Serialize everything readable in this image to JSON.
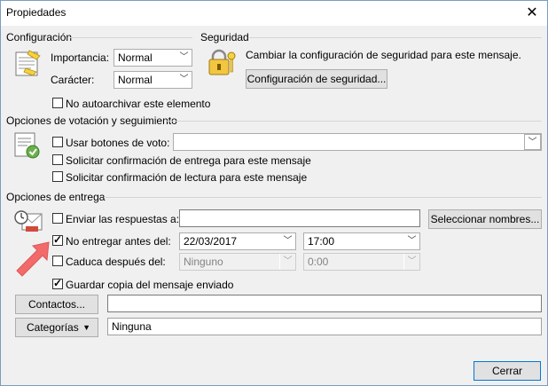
{
  "window": {
    "title": "Propiedades",
    "close_glyph": "✕"
  },
  "config": {
    "heading": "Configuración",
    "importance_label": "Importancia:",
    "importance_value": "Normal",
    "sensitivity_label": "Carácter:",
    "sensitivity_value": "Normal",
    "no_autoarchive_label": "No autoarchivar este elemento",
    "no_autoarchive_checked": false
  },
  "security": {
    "heading": "Seguridad",
    "description": "Cambiar la configuración de seguridad para este mensaje.",
    "button_label": "Configuración de seguridad..."
  },
  "voting": {
    "heading": "Opciones de votación y seguimiento",
    "use_voting_label": "Usar botones de voto:",
    "use_voting_value": "",
    "delivery_receipt_label": "Solicitar confirmación de entrega para este mensaje",
    "read_receipt_label": "Solicitar confirmación de lectura para este mensaje"
  },
  "delivery": {
    "heading": "Opciones de entrega",
    "send_replies_label": "Enviar las respuestas a:",
    "send_replies_value": "",
    "select_names_label": "Seleccionar nombres...",
    "do_not_deliver_label": "No entregar antes del:",
    "do_not_deliver_checked": true,
    "date_value": "22/03/2017",
    "time_value": "17:00",
    "expires_label": "Caduca después del:",
    "expires_checked": false,
    "expires_date_value": "Ninguno",
    "expires_time_value": "0:00",
    "save_copy_label": "Guardar copia del mensaje enviado",
    "save_copy_checked": true
  },
  "contacts": {
    "button_label": "Contactos...",
    "value": ""
  },
  "categories": {
    "button_label": "Categorías",
    "value": "Ninguna"
  },
  "footer": {
    "close_label": "Cerrar"
  },
  "colors": {
    "accent": "#0078d7",
    "arrow": "#f26b6b",
    "dialog_bg": "#f0f0f0"
  }
}
